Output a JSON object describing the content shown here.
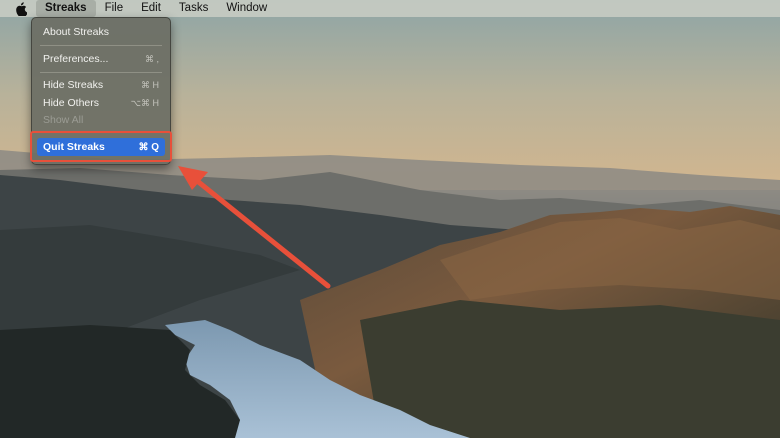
{
  "menubar": {
    "apple_icon": "apple-logo-icon",
    "app_name": "Streaks",
    "items": [
      "File",
      "Edit",
      "Tasks",
      "Window"
    ]
  },
  "dropdown": {
    "about": "About Streaks",
    "preferences": "Preferences...",
    "preferences_shortcut": "⌘ ,",
    "hide": "Hide Streaks",
    "hide_shortcut": "⌘ H",
    "hide_others": "Hide Others",
    "hide_others_shortcut": "⌥⌘ H",
    "show_all": "Show All",
    "quit": "Quit Streaks",
    "quit_shortcut": "⌘ Q"
  },
  "colors": {
    "highlight": "#2f6fda",
    "annotation": "#e8503a"
  }
}
